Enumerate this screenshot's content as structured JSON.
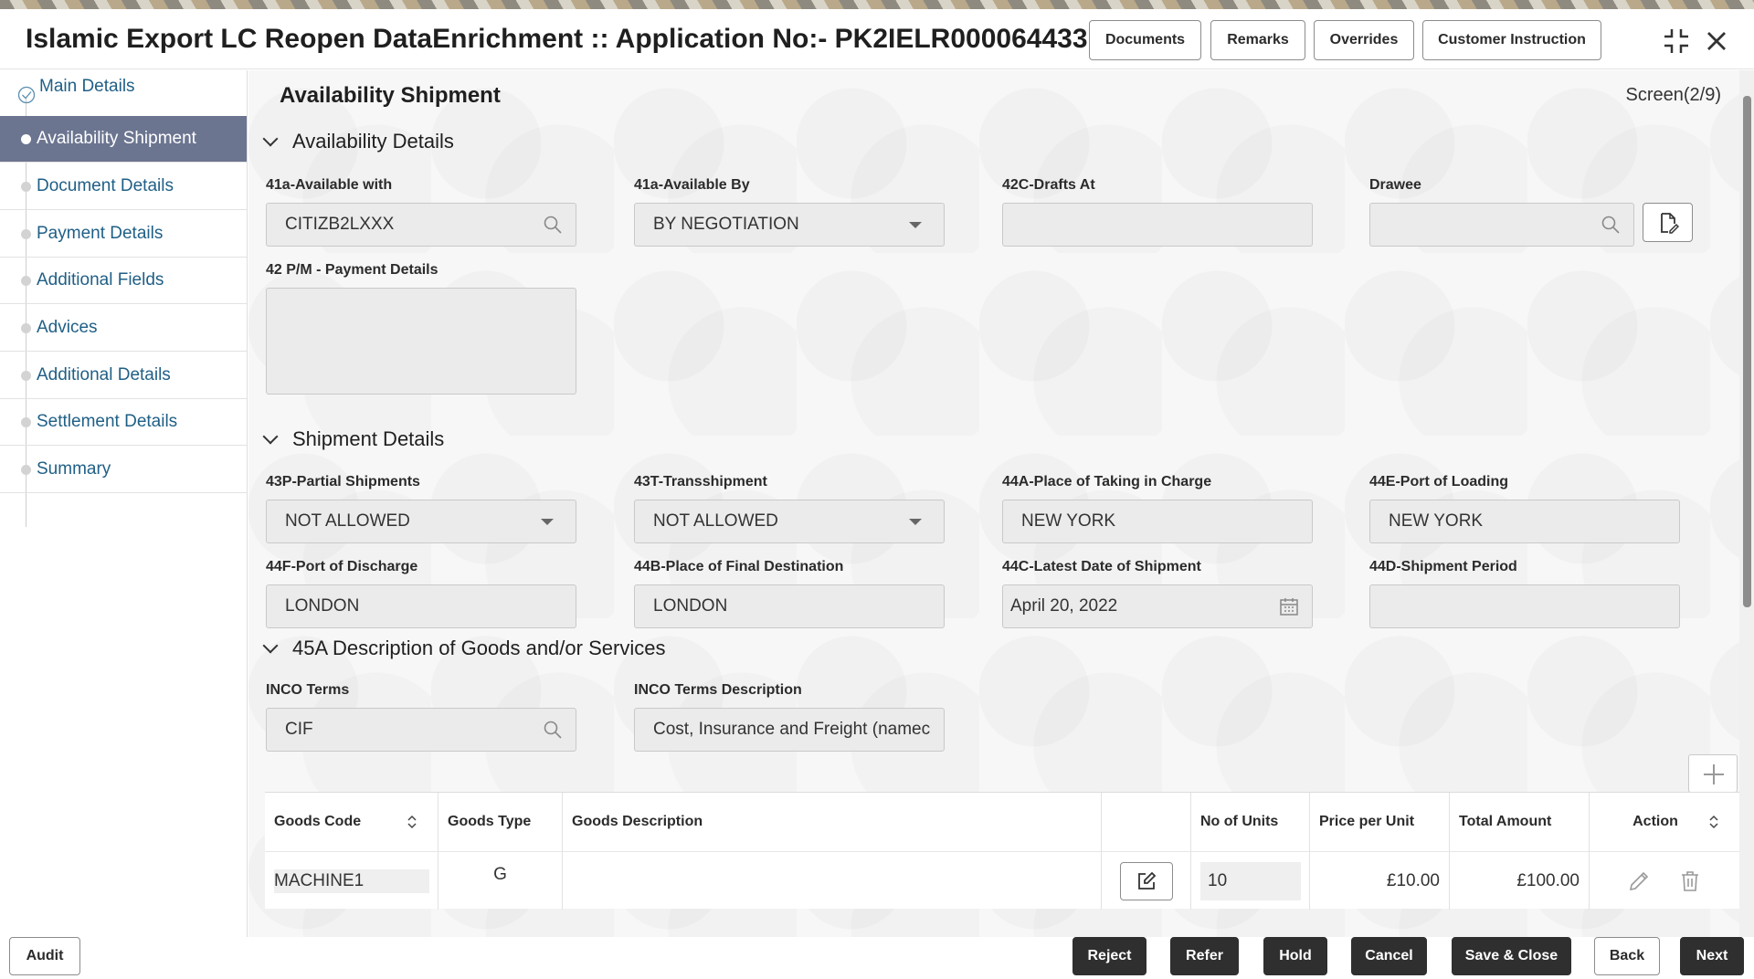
{
  "header": {
    "title": "Islamic Export LC Reopen DataEnrichment :: Application No:- PK2IELR000064433",
    "buttons": [
      "Documents",
      "Remarks",
      "Overrides",
      "Customer Instruction"
    ]
  },
  "sidebar": {
    "items": [
      {
        "label": "Main Details",
        "state": "completed"
      },
      {
        "label": "Availability Shipment",
        "state": "active"
      },
      {
        "label": "Document Details",
        "state": "pending"
      },
      {
        "label": "Payment Details",
        "state": "pending"
      },
      {
        "label": "Additional Fields",
        "state": "pending"
      },
      {
        "label": "Advices",
        "state": "pending"
      },
      {
        "label": "Additional Details",
        "state": "pending"
      },
      {
        "label": "Settlement Details",
        "state": "pending"
      },
      {
        "label": "Summary",
        "state": "pending"
      }
    ]
  },
  "main": {
    "page_title": "Availability Shipment",
    "screen_no": "Screen(2/9)",
    "availability": {
      "section_title": "Availability Details",
      "available_with_label": "41a-Available with",
      "available_with_value": "CITIZB2LXXX",
      "available_by_label": "41a-Available By",
      "available_by_value": "BY NEGOTIATION",
      "drafts_at_label": "42C-Drafts At",
      "drafts_at_value": "",
      "drawee_label": "Drawee",
      "drawee_value": "",
      "payment_details_label": "42 P/M - Payment Details",
      "payment_details_value": ""
    },
    "shipment": {
      "section_title": "Shipment Details",
      "partial_label": "43P-Partial Shipments",
      "partial_value": "NOT ALLOWED",
      "transship_label": "43T-Transshipment",
      "transship_value": "NOT ALLOWED",
      "taking_charge_label": "44A-Place of Taking in Charge",
      "taking_charge_value": "NEW YORK",
      "port_loading_label": "44E-Port of Loading",
      "port_loading_value": "NEW YORK",
      "port_discharge_label": "44F-Port of Discharge",
      "port_discharge_value": "LONDON",
      "final_dest_label": "44B-Place of Final Destination",
      "final_dest_value": "LONDON",
      "latest_date_label": "44C-Latest Date of Shipment",
      "latest_date_value": "April 20, 2022",
      "period_label": "44D-Shipment Period",
      "period_value": ""
    },
    "goods": {
      "section_title": "45A Description of Goods and/or Services",
      "inco_label": "INCO Terms",
      "inco_value": "CIF",
      "inco_desc_label": "INCO Terms Description",
      "inco_desc_value": "Cost, Insurance and Freight (namec",
      "table": {
        "headers": [
          "Goods Code",
          "Goods Type",
          "Goods Description",
          "",
          "No of Units",
          "Price per Unit",
          "Total Amount",
          "Action"
        ],
        "rows": [
          {
            "goods_code": "MACHINE1",
            "goods_type": "G",
            "goods_description": "",
            "units": "10",
            "price": "£10.00",
            "total": "£100.00"
          }
        ]
      }
    }
  },
  "footer": {
    "audit": "Audit",
    "buttons": [
      "Reject",
      "Refer",
      "Hold",
      "Cancel",
      "Save & Close",
      "Back",
      "Next"
    ]
  }
}
